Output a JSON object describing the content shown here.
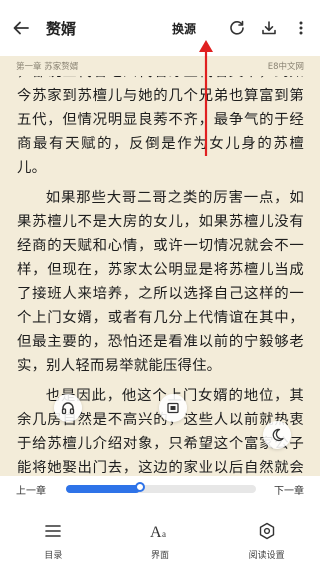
{
  "header": {
    "title": "赘婿",
    "switch_source": "换源",
    "back_icon": "back-arrow-icon",
    "refresh_icon": "refresh-icon",
    "download_icon": "download-icon",
    "more_icon": "more-vertical-icon"
  },
  "chapter": {
    "name": "第一章 苏家赘婿",
    "source": "E8中文网"
  },
  "content": {
    "paragraphs": [
      "，都说三代看吃四代看穿五代看文章，到如今苏家到苏檀儿与她的几个兄弟也算富到第五代，但情况明显良莠不齐，最争气的于经商最有天赋的，反倒是作为女儿身的苏檀儿。",
      "如果那些大哥二哥之类的厉害一点，如果苏檀儿不是大房的女儿，如果苏檀儿没有经商的天赋和心情，或许一切情况就会不一样，但现在，苏家太公明显是将苏檀儿当成了接班人来培养，之所以选择自己这样的一个上门女婿，或者有几分上代情谊在其中，但最主要的，恐怕还是看准以前的宁毅够老实，别人轻而易举就能压得住。",
      "也是因此，他这个上门女婿的地位，其余几房自然是不高兴的，这些人以前就热衷于给苏檀儿介绍对象，只希望这个富家公子能将她娶出门去，这边的家业以后自然就会落到自己那一房手里。"
    ]
  },
  "floating": {
    "headphone_icon": "headphones-icon",
    "brightness_icon": "screen-brightness-icon",
    "night_icon": "moon-icon"
  },
  "progress": {
    "prev_label": "上一章",
    "next_label": "下一章",
    "value": 0.39
  },
  "bottom_tabs": [
    {
      "label": "目录",
      "icon": "menu-list-icon"
    },
    {
      "label": "界面",
      "icon": "font-size-icon"
    },
    {
      "label": "阅读设置",
      "icon": "settings-hexagon-icon"
    }
  ],
  "colors": {
    "page_background": "#f3ecd9",
    "accent": "#2e73e8",
    "annotation_arrow": "#e02020"
  }
}
